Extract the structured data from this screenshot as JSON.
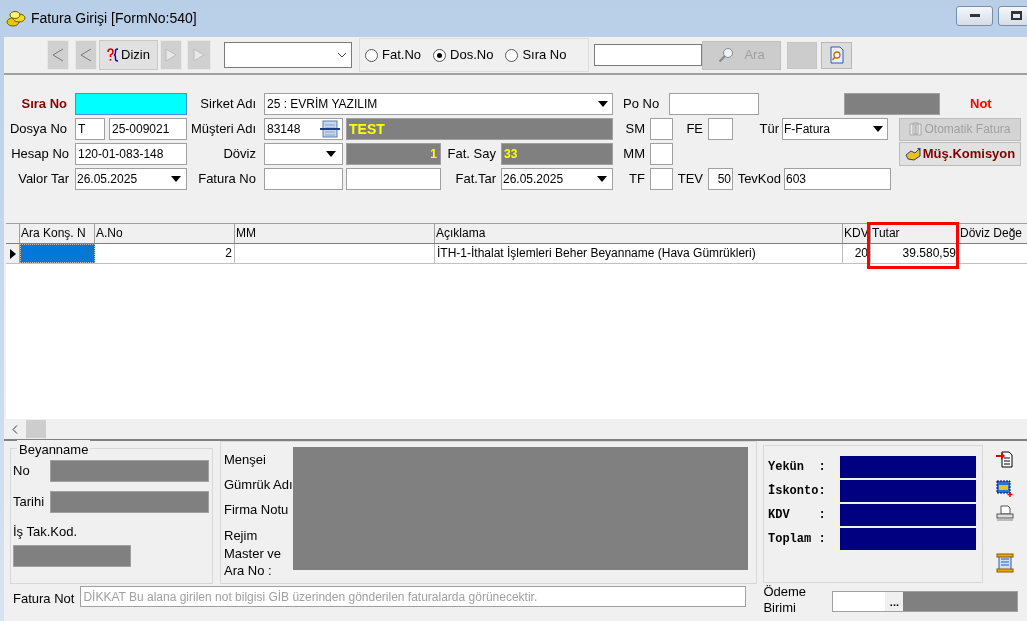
{
  "window": {
    "title": "Fatura Girişi [FormNo:540]"
  },
  "toolbar": {
    "dizin_button": "Dizin",
    "search_mode": [
      {
        "label": "Fat.No",
        "selected": false
      },
      {
        "label": "Dos.No",
        "selected": true
      },
      {
        "label": "Sıra No",
        "selected": false
      }
    ],
    "search_button": {
      "label": "Ara",
      "disabled": true
    }
  },
  "header": {
    "sira_no_label": "Sıra No",
    "sirket_adi_label": "Sirket Adı",
    "sirket_adi": "25 : EVRİM YAZILIM",
    "po_no_label": "Po No",
    "not_label": "Not",
    "dosya_no_label": "Dosya No",
    "dosya_prefix": "T",
    "dosya_no": "25-009021",
    "musteri_adi_label": "Müşteri Adı",
    "musteri_kodu": "83148",
    "musteri_adi": "TEST",
    "sm_label": "SM",
    "fe_label": "FE",
    "tur_label": "Tür",
    "tur": "F-Fatura",
    "otomatik_fatura_button": {
      "label": "Otomatik Fatura",
      "disabled": true
    },
    "hesap_no_label": "Hesap No",
    "hesap_no": "120-01-083-148",
    "doviz_label": "Döviz",
    "doviz_kur": "1",
    "fat_say_label": "Fat. Say",
    "fat_say": "33",
    "mm_label": "MM",
    "komisyon_button": {
      "label": "Müş.Komisyon",
      "disabled": false
    },
    "valor_tar_label": "Valor Tar",
    "valor_tar": "26.05.2025",
    "fatura_no_label": "Fatura No",
    "fat_tar_label": "Fat.Tar",
    "fat_tar": "26.05.2025",
    "tf_label": "TF",
    "tev_label": "TEV",
    "tev": "50",
    "tevkod_label": "TevKod",
    "tevkod": "603"
  },
  "table": {
    "columns": [
      {
        "label": "Ara Konş. N",
        "highlighted": false
      },
      {
        "label": "A.No",
        "highlighted": false
      },
      {
        "label": "MM",
        "highlighted": false
      },
      {
        "label": "Açıklama",
        "highlighted": false
      },
      {
        "label": "KDV",
        "highlighted": false
      },
      {
        "label": "Tutar",
        "highlighted": true
      },
      {
        "label": "Döviz Değe",
        "highlighted": false
      }
    ],
    "rows": [
      {
        "selected": true,
        "a_no": "2",
        "aciklama": "İTH-1-İthalat İşlemleri Beher Beyanname (Hava Gümrükleri)",
        "kdv": "20",
        "tutar": "39.580,59"
      }
    ]
  },
  "beyanname": {
    "title": "Beyanname",
    "no_label": "No",
    "tarihi_label": "Tarihi",
    "is_tak_kod_label": "İş Tak.Kod."
  },
  "details": {
    "mensei_label": "Menşei",
    "gumruk_adi_label": "Gümrük Adı",
    "firma_notu_label": "Firma Notu",
    "rejim_label": "Rejim",
    "master_label": "Master ve Ara No :"
  },
  "totals": [
    {
      "label": "Yekün  :"
    },
    {
      "label": "İskonto:"
    },
    {
      "label": "KDV    :"
    },
    {
      "label": "Toplam :"
    }
  ],
  "fatura_not": {
    "label": "Fatura Not",
    "placeholder": "DİKKAT Bu alana girilen not bilgisi GİB üzerinden gönderilen faturalarda görünecektir."
  },
  "odeme_birimi": {
    "label": "Ödeme Birimi",
    "button": "..."
  }
}
